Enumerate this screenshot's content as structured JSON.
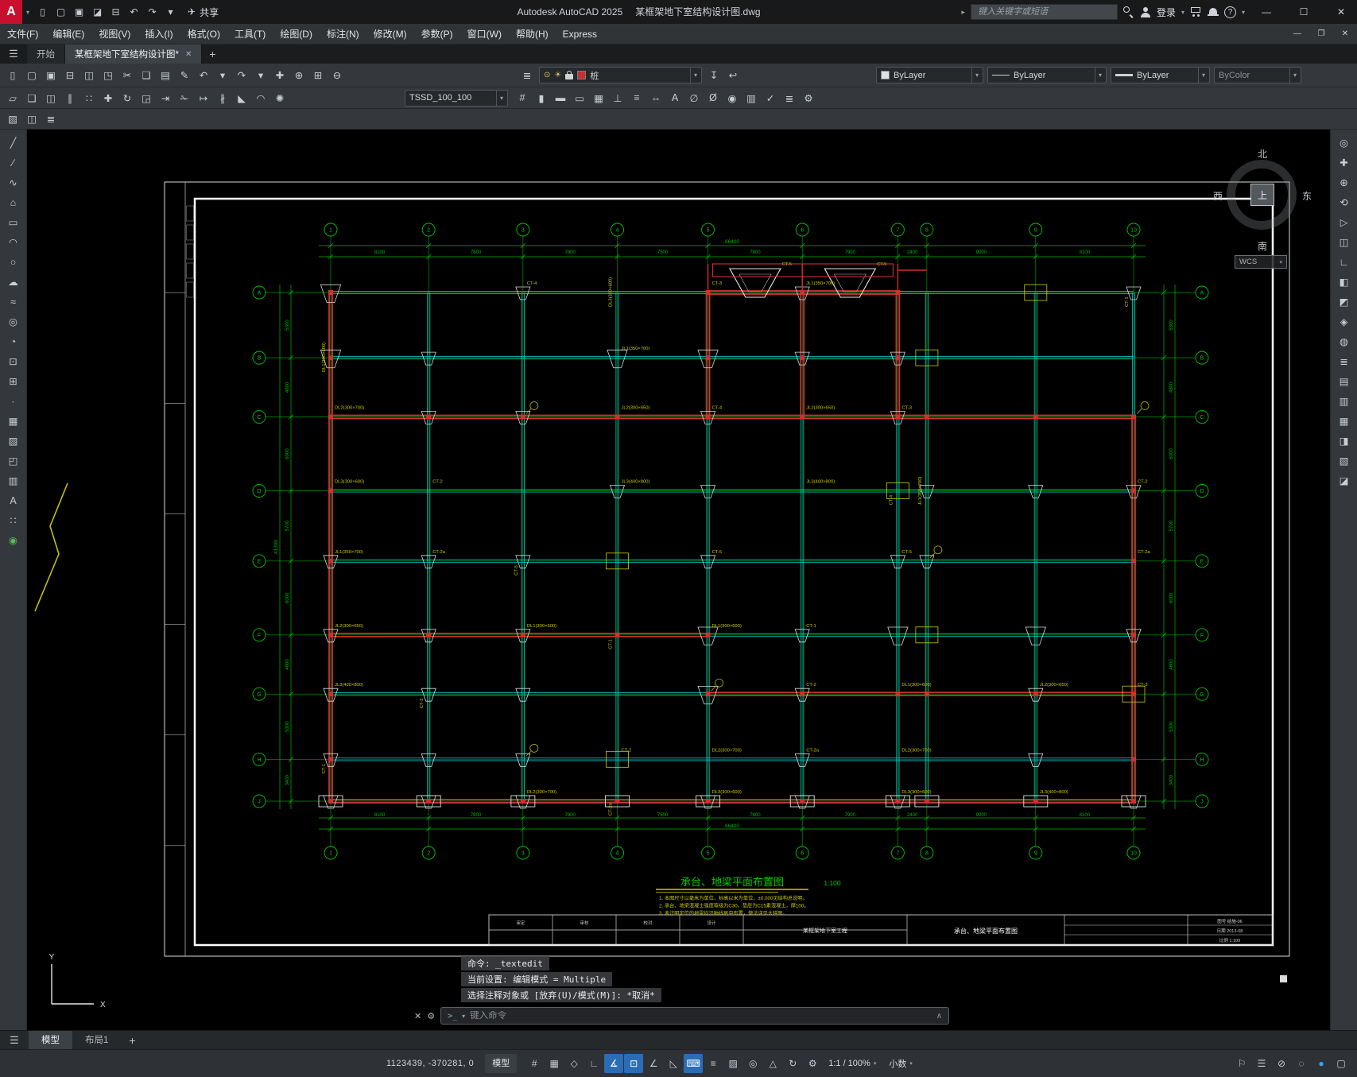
{
  "colors": {
    "accent_red": "#c8102e",
    "grid_green": "#00a800",
    "dim_green": "#00b800",
    "bubble_green": "#00c800",
    "beam_red": "#d03030",
    "beam_cyan": "#00bcbc",
    "anno_yellow": "#cccc00",
    "sheet_white": "#ffffff",
    "active_blue": "#2a6db5",
    "perf_blue": "#3aa0ff"
  },
  "titlebar": {
    "logo_letter": "A",
    "app_name": "Autodesk AutoCAD 2025",
    "doc_name": "某框架地下室结构设计图.dwg",
    "share_label": "共享",
    "share_icon_glyph": "✈",
    "search_placeholder": "键入关键字或短语",
    "login_label": "登录",
    "quick_icons": [
      {
        "name": "new-file-icon",
        "glyph": "▯"
      },
      {
        "name": "open-file-icon",
        "glyph": "▢"
      },
      {
        "name": "save-file-icon",
        "glyph": "▣"
      },
      {
        "name": "save-as-icon",
        "glyph": "◪"
      },
      {
        "name": "plot-icon",
        "glyph": "⊟"
      },
      {
        "name": "undo-icon",
        "glyph": "↶"
      },
      {
        "name": "redo-icon",
        "glyph": "↷"
      },
      {
        "name": "qat-dropdown-icon",
        "glyph": "▾"
      }
    ]
  },
  "menubar": {
    "items": [
      {
        "label": "文件(F)",
        "name": "menu-file"
      },
      {
        "label": "编辑(E)",
        "name": "menu-edit"
      },
      {
        "label": "视图(V)",
        "name": "menu-view"
      },
      {
        "label": "插入(I)",
        "name": "menu-insert"
      },
      {
        "label": "格式(O)",
        "name": "menu-format"
      },
      {
        "label": "工具(T)",
        "name": "menu-tools"
      },
      {
        "label": "绘图(D)",
        "name": "menu-draw"
      },
      {
        "label": "标注(N)",
        "name": "menu-dimension"
      },
      {
        "label": "修改(M)",
        "name": "menu-modify"
      },
      {
        "label": "参数(P)",
        "name": "menu-parametric"
      },
      {
        "label": "窗口(W)",
        "name": "menu-window"
      },
      {
        "label": "帮助(H)",
        "name": "menu-help"
      },
      {
        "label": "Express",
        "name": "menu-express"
      }
    ]
  },
  "filetabs": {
    "hamburger_glyph": "☰",
    "new_tab_glyph": "+",
    "tabs": [
      {
        "label": "开始",
        "active": false,
        "closable": false
      },
      {
        "label": "某框架地下室结构设计图*",
        "active": true,
        "closable": true
      }
    ]
  },
  "toolbar1": {
    "icons_left": [
      {
        "name": "qnew-icon",
        "glyph": "▯"
      },
      {
        "name": "open-icon",
        "glyph": "▢"
      },
      {
        "name": "save-icon",
        "glyph": "▣"
      },
      {
        "name": "plot-icon",
        "glyph": "⊟"
      },
      {
        "name": "plot-preview-icon",
        "glyph": "◫"
      },
      {
        "name": "publish-icon",
        "glyph": "◳"
      },
      {
        "name": "cut-icon",
        "glyph": "✂"
      },
      {
        "name": "copy-icon",
        "glyph": "❏"
      },
      {
        "name": "paste-icon",
        "glyph": "▤"
      },
      {
        "name": "match-properties-icon",
        "glyph": "✎"
      },
      {
        "name": "undo-icon",
        "glyph": "↶"
      },
      {
        "name": "undo-dropdown-icon",
        "glyph": "▾"
      },
      {
        "name": "redo-icon",
        "glyph": "↷"
      },
      {
        "name": "redo-dropdown-icon",
        "glyph": "▾"
      },
      {
        "name": "pan-icon",
        "glyph": "✚"
      },
      {
        "name": "zoom-realtime-icon",
        "glyph": "⊕"
      },
      {
        "name": "zoom-window-icon",
        "glyph": "⊞"
      },
      {
        "name": "zoom-previous-icon",
        "glyph": "⊖"
      }
    ],
    "layer_manager_icon": {
      "name": "layer-properties-icon",
      "glyph": "≣"
    },
    "layer_combo": {
      "value": "桩",
      "chip_color": "#c43030",
      "bulb_glyph": "⊙",
      "sun_glyph": "☀"
    },
    "post_layer_icons": [
      {
        "name": "make-object-layer-current-icon",
        "glyph": "↧"
      },
      {
        "name": "layer-previous-icon",
        "glyph": "↩"
      }
    ],
    "color_combo": {
      "value": "ByLayer",
      "chip_color": "#e0e0e0"
    },
    "linetype_combo": {
      "value": "ByLayer"
    },
    "lineweight_combo": {
      "value": "ByLayer"
    },
    "plotstyle_combo": {
      "value": "ByColor"
    }
  },
  "toolbar2": {
    "icons_left": [
      {
        "name": "erase-icon",
        "glyph": "▱"
      },
      {
        "name": "copy-object-icon",
        "glyph": "❏"
      },
      {
        "name": "mirror-icon",
        "glyph": "◫"
      },
      {
        "name": "offset-icon",
        "glyph": "∥"
      },
      {
        "name": "array-icon",
        "glyph": "∷"
      },
      {
        "name": "move-icon",
        "glyph": "✚"
      },
      {
        "name": "rotate-icon",
        "glyph": "↻"
      },
      {
        "name": "scale-icon",
        "glyph": "◲"
      },
      {
        "name": "stretch-icon",
        "glyph": "⇥"
      },
      {
        "name": "trim-icon",
        "glyph": "✁"
      },
      {
        "name": "extend-icon",
        "glyph": "↦"
      },
      {
        "name": "break-icon",
        "glyph": "∦"
      },
      {
        "name": "chamfer-icon",
        "glyph": "◣"
      },
      {
        "name": "fillet-icon",
        "glyph": "◠"
      },
      {
        "name": "explode-icon",
        "glyph": "✺"
      }
    ],
    "style_combo": {
      "value": "TSSD_100_100"
    },
    "icons_right": [
      {
        "name": "tssd-grid-tool-icon",
        "glyph": "#"
      },
      {
        "name": "tssd-column-tool-icon",
        "glyph": "▮"
      },
      {
        "name": "tssd-beam-tool-icon",
        "glyph": "▬"
      },
      {
        "name": "tssd-wall-tool-icon",
        "glyph": "▭"
      },
      {
        "name": "tssd-slab-tool-icon",
        "glyph": "▦"
      },
      {
        "name": "tssd-foundation-tool-icon",
        "glyph": "⊥"
      },
      {
        "name": "tssd-stair-tool-icon",
        "glyph": "≡"
      },
      {
        "name": "tssd-dimension-tool-icon",
        "glyph": "↔"
      },
      {
        "name": "tssd-text-tool-icon",
        "glyph": "A"
      },
      {
        "name": "tssd-rebar-tool-icon",
        "glyph": "∅"
      },
      {
        "name": "tssd-section-tool-icon",
        "glyph": "Ø"
      },
      {
        "name": "tssd-detail-tool-icon",
        "glyph": "◉"
      },
      {
        "name": "tssd-table-tool-icon",
        "glyph": "▥"
      },
      {
        "name": "tssd-check-tool-icon",
        "glyph": "✓"
      },
      {
        "name": "tssd-layer-tool-icon",
        "glyph": "≣"
      },
      {
        "name": "tssd-settings-tool-icon",
        "glyph": "⚙"
      }
    ]
  },
  "toolbar3": {
    "icons": [
      {
        "name": "tssd-image-icon",
        "glyph": "▧"
      },
      {
        "name": "tssd-xref-icon",
        "glyph": "◫"
      },
      {
        "name": "tssd-manage-icon",
        "glyph": "≣"
      }
    ]
  },
  "left_toolbar": {
    "tools": [
      {
        "name": "line-tool-icon",
        "glyph": "╱"
      },
      {
        "name": "construction-line-tool-icon",
        "glyph": "∕"
      },
      {
        "name": "polyline-tool-icon",
        "glyph": "∿"
      },
      {
        "name": "polygon-tool-icon",
        "glyph": "⌂"
      },
      {
        "name": "rectangle-tool-icon",
        "glyph": "▭"
      },
      {
        "name": "arc-tool-icon",
        "glyph": "◠"
      },
      {
        "name": "circle-tool-icon",
        "glyph": "○"
      },
      {
        "name": "revision-cloud-tool-icon",
        "glyph": "☁"
      },
      {
        "name": "spline-tool-icon",
        "glyph": "≈"
      },
      {
        "name": "ellipse-tool-icon",
        "glyph": "◎"
      },
      {
        "name": "ellipse-arc-tool-icon",
        "glyph": "◔"
      },
      {
        "name": "insert-block-tool-icon",
        "glyph": "⊡"
      },
      {
        "name": "create-block-tool-icon",
        "glyph": "⊞"
      },
      {
        "name": "point-tool-icon",
        "glyph": "∙"
      },
      {
        "name": "hatch-tool-icon",
        "glyph": "▦"
      },
      {
        "name": "gradient-tool-icon",
        "glyph": "▨"
      },
      {
        "name": "region-tool-icon",
        "glyph": "◰"
      },
      {
        "name": "table-tool-icon",
        "glyph": "▥"
      },
      {
        "name": "multiline-text-tool-icon",
        "glyph": "A"
      },
      {
        "name": "divide-tool-icon",
        "glyph": "∷"
      },
      {
        "name": "point-style-tool-icon",
        "glyph": "◉",
        "color": "#58b858"
      }
    ]
  },
  "right_toolbar": {
    "tools": [
      {
        "name": "full-navigation-wheel-icon",
        "glyph": "◎"
      },
      {
        "name": "pan-hand-icon",
        "glyph": "✚"
      },
      {
        "name": "zoom-extents-icon",
        "glyph": "⊕"
      },
      {
        "name": "orbit-icon",
        "glyph": "⟲"
      },
      {
        "name": "showmotion-icon",
        "glyph": "▷"
      },
      {
        "name": "viewcube-toggle-icon",
        "glyph": "◫"
      },
      {
        "name": "ucs-toggle-icon",
        "glyph": "∟"
      },
      {
        "name": "view-front-icon",
        "glyph": "◧"
      },
      {
        "name": "view-top-icon",
        "glyph": "◩"
      },
      {
        "name": "view-3d-icon",
        "glyph": "◈"
      },
      {
        "name": "steering-wheel-icon",
        "glyph": "◍"
      },
      {
        "name": "layers-panel-icon",
        "glyph": "≣"
      },
      {
        "name": "properties-panel-icon",
        "glyph": "▤"
      },
      {
        "name": "tool-palettes-icon",
        "glyph": "▥"
      },
      {
        "name": "sheet-set-manager-icon",
        "glyph": "▦"
      },
      {
        "name": "render-panel-icon",
        "glyph": "◨"
      },
      {
        "name": "materials-panel-icon",
        "glyph": "▧"
      },
      {
        "name": "visual-styles-icon",
        "glyph": "◪"
      }
    ]
  },
  "viewcube": {
    "north": "北",
    "south": "南",
    "east": "东",
    "west": "西",
    "center": "上",
    "wcs_label": "WCS"
  },
  "command": {
    "lines": [
      "命令: _textedit",
      "当前设置: 编辑模式 = Multiple",
      "选择注释对象或 [放弃(U)/模式(M)]: *取消*"
    ],
    "input_placeholder": "键入命令",
    "close_glyph": "✕",
    "customize_glyph": "⚙",
    "collapse_glyph": "∧",
    "prompt_glyph": ">_"
  },
  "layout_tabs": {
    "hamburger_glyph": "☰",
    "new_tab_glyph": "+",
    "tabs": [
      {
        "label": "模型",
        "active": true
      },
      {
        "label": "布局1",
        "active": false
      }
    ]
  },
  "statusbar": {
    "coords": "1123439, -370281, 0",
    "model_label": "模型",
    "scale_label": "1:1 / 100%",
    "units_label": "小数",
    "icons_left": [
      {
        "name": "grid-display-icon",
        "glyph": "#",
        "active": false
      },
      {
        "name": "snap-mode-icon",
        "glyph": "▦",
        "active": false
      },
      {
        "name": "infer-constraints-icon",
        "glyph": "◇",
        "active": false
      },
      {
        "name": "ortho-mode-icon",
        "glyph": "∟",
        "active": false
      },
      {
        "name": "polar-tracking-icon",
        "glyph": "∡",
        "active": true
      },
      {
        "name": "object-snap-icon",
        "glyph": "⊡",
        "active": true
      },
      {
        "name": "object-snap-tracking-icon",
        "glyph": "∠",
        "active": false
      },
      {
        "name": "dynamic-ucs-icon",
        "glyph": "◺",
        "active": false
      },
      {
        "name": "dynamic-input-icon",
        "glyph": "⌨",
        "active": true
      },
      {
        "name": "lineweight-display-icon",
        "glyph": "≡",
        "active": false
      },
      {
        "name": "transparency-icon",
        "glyph": "▨",
        "active": false
      },
      {
        "name": "selection-cycling-icon",
        "glyph": "◎",
        "active": false
      },
      {
        "name": "annotation-visibility-icon",
        "glyph": "△",
        "active": false
      },
      {
        "name": "annotation-autoscale-icon",
        "glyph": "↻",
        "active": false
      },
      {
        "name": "workspace-switching-icon",
        "glyph": "⚙",
        "active": false
      }
    ],
    "icons_right": [
      {
        "name": "annotation-monitor-icon",
        "glyph": "⚐"
      },
      {
        "name": "quick-properties-icon",
        "glyph": "☰"
      },
      {
        "name": "lock-ui-icon",
        "glyph": "⊘"
      },
      {
        "name": "isolate-objects-icon",
        "glyph": "◌"
      },
      {
        "name": "graphics-performance-icon",
        "glyph": "●",
        "color": "#3aa0ff"
      },
      {
        "name": "clean-screen-icon",
        "glyph": "▢"
      }
    ]
  },
  "drawing": {
    "title": "承台、地梁平面布置图",
    "scale": "1:100",
    "notes": [
      "1. 本图尺寸以毫米为单位，标高以米为单位，±0.000见结构总说明。",
      "2. 承台、地梁混凝土强度等级为C30，垫层为C15素混凝土，厚100。",
      "3. 未注明定位的地梁均沿轴线居中布置，做法详见大样图。"
    ],
    "ucs": {
      "x_label": "X",
      "y_label": "Y"
    },
    "top_axes": {
      "labels": [
        "1",
        "2",
        "3",
        "4",
        "5",
        "6",
        "7",
        "8",
        "9",
        "10"
      ],
      "spacings": [
        "8100",
        "7800",
        "7800",
        "7500",
        "7800",
        "7900",
        "2400",
        "9000",
        "8100"
      ],
      "total": "66400"
    },
    "side_axes": {
      "labels": [
        "A",
        "B",
        "C",
        "D",
        "E",
        "F",
        "G",
        "H",
        "J"
      ],
      "spacings": [
        "5300",
        "4800",
        "6000",
        "5700",
        "6000",
        "4800",
        "5300",
        "3400"
      ],
      "total": "41300"
    },
    "beam_labels": [
      "DL1(300×600)",
      "DL2(300×700)",
      "DL3(300×600)",
      "JL1(350×700)",
      "JL2(300×650)",
      "JL3(400×800)",
      "CT-1",
      "CT-2",
      "CT-2a",
      "CT-3",
      "CT-4",
      "CT-5"
    ],
    "titleblock": {
      "roles": [
        "审定",
        "审核",
        "校对",
        "设计"
      ],
      "project": "某框架地下室工程",
      "drawing_name": "承台、地梁平面布置图",
      "no_label": "图号",
      "drawing_no": "结施-06",
      "date_label": "日期",
      "date": "2013-08",
      "scale_label": "比例",
      "scale": "1:100"
    }
  }
}
